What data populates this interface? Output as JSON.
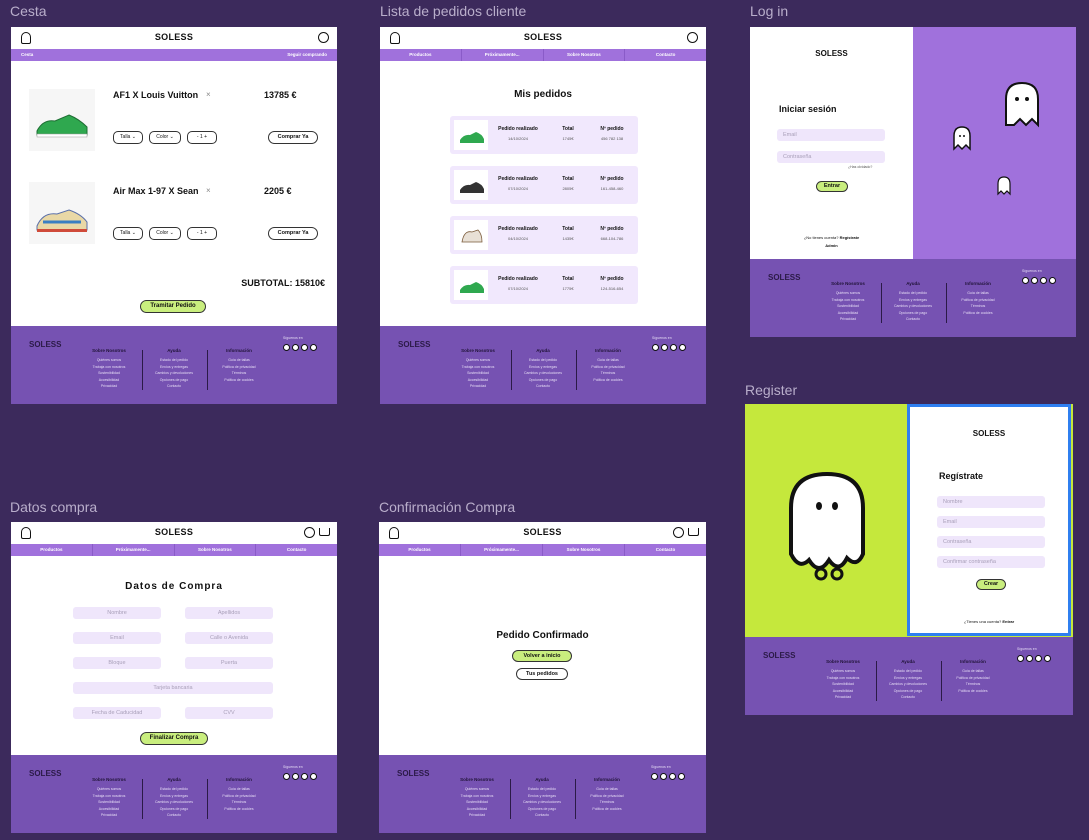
{
  "frames": {
    "cesta": "Cesta",
    "lista": "Lista de pedidos cliente",
    "login": "Log in",
    "register": "Register",
    "datos": "Datos compra",
    "confirm": "Confirmación Compra"
  },
  "brand": "SOLESS",
  "nav": [
    "Productos",
    "Próximamente...",
    "Sobre Nosotros",
    "Contacto"
  ],
  "cesta": {
    "nav_left": "Cesta",
    "nav_right": "Seguir comprando",
    "items": [
      {
        "name": "AF1 X Louis Vuitton",
        "price": "13785 €"
      },
      {
        "name": "Air Max 1-97 X Sean",
        "price": "2205 €"
      }
    ],
    "talla": "Talla",
    "color": "Color",
    "qty": "- 1 +",
    "remove": "×",
    "buy_now": "Comprar Ya",
    "subtotal": "SUBTOTAL: 15810€",
    "checkout": "Tramitar Pedido"
  },
  "pedidos": {
    "title": "Mis pedidos",
    "col_date": "Pedido realizado",
    "col_total": "Total",
    "col_num": "Nº pedido",
    "rows": [
      {
        "date": "14/10/2024",
        "total": "1745€",
        "num": "456 782 138"
      },
      {
        "date": "07/10/2024",
        "total": "2805€",
        "num": "161-458-460"
      },
      {
        "date": "04/10/2024",
        "total": "1435€",
        "num": "668-104-786"
      },
      {
        "date": "07/10/2024",
        "total": "1775€",
        "num": "124-516-654"
      }
    ]
  },
  "login": {
    "title": "Iniciar sesión",
    "email": "Email",
    "password": "Contraseña",
    "forgot": "¿Has olvidado?",
    "submit": "Entrar",
    "no_account": "¿No tienes cuenta?",
    "register": "Regístrate",
    "admin": "Admin"
  },
  "register": {
    "title": "Regístrate",
    "fields": [
      "Nombre",
      "Email",
      "Contraseña",
      "Confirmar contraseña"
    ],
    "submit": "Crear",
    "have_account": "¿Tienes una cuenta?",
    "login": "Entrar"
  },
  "datos": {
    "title": "Datos de Compra",
    "fields": [
      "Nombre",
      "Apellidos",
      "Email",
      "Calle o Avenida",
      "Bloque",
      "Puerta",
      "Tarjeta bancaria",
      "Fecha de Caducidad",
      "CVV"
    ],
    "submit": "Finalizar Compra"
  },
  "confirm": {
    "title": "Pedido Confirmado",
    "home": "Volver a inicio",
    "orders": "Tus pedidos"
  },
  "footer": {
    "brand": "SOLESS",
    "social": "Síguenos en",
    "cols": [
      {
        "title": "Sobre Nosotros",
        "items": [
          "Quiénes somos",
          "Trabaja con nosotros",
          "Sostenibilidad",
          "Accesibilidad",
          "Privacidad"
        ]
      },
      {
        "title": "Ayuda",
        "items": [
          "Estado del pedido",
          "Envíos y entregas",
          "Cambios y devoluciones",
          "Opciones de pago",
          "Contacto"
        ]
      },
      {
        "title": "Información",
        "items": [
          "Guía de tallas",
          "Política de privacidad",
          "Términos",
          "Política de cookies"
        ]
      }
    ]
  },
  "colors": {
    "purple": "#a071dc",
    "footer": "#7652b2",
    "lime": "#c5e83c",
    "bg": "#3c2a5c"
  }
}
